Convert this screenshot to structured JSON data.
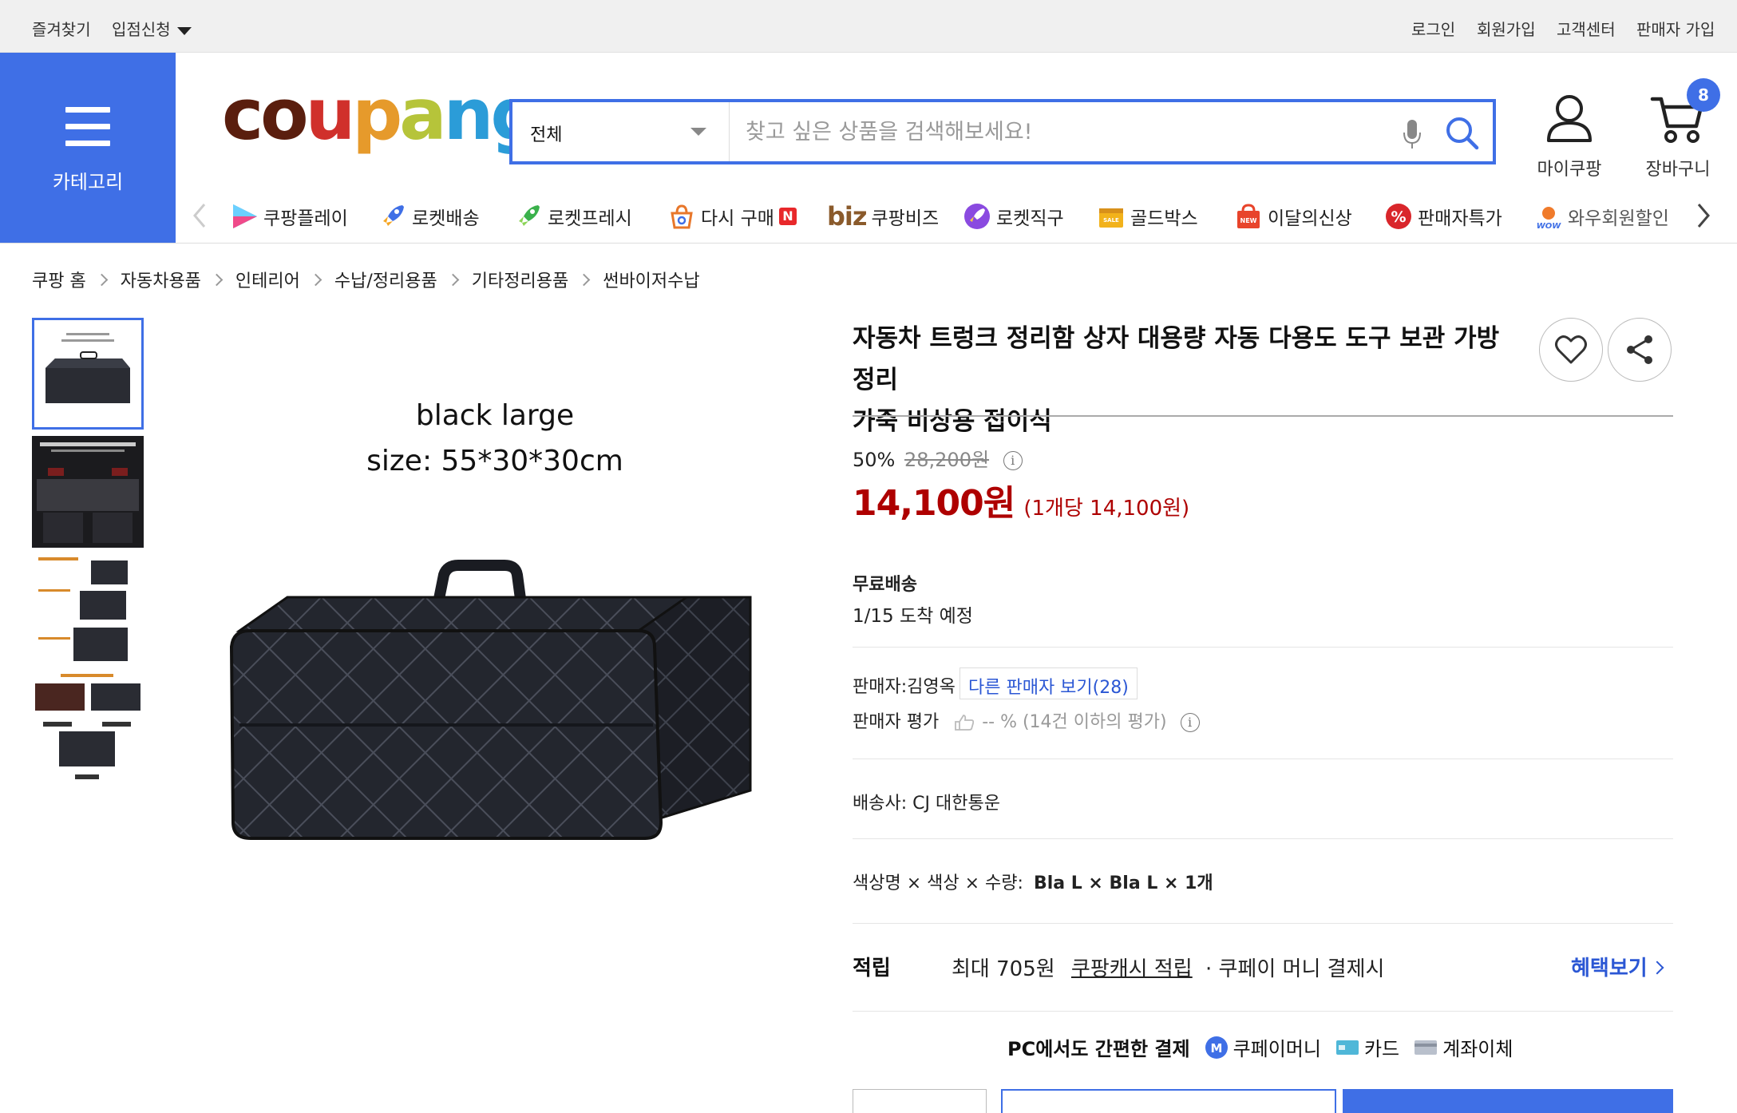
{
  "topbar": {
    "left": [
      "즐겨찾기",
      "입점신청"
    ],
    "right": [
      "로그인",
      "회원가입",
      "고객센터",
      "판매자 가입"
    ]
  },
  "header": {
    "category_label": "카테고리",
    "logo_text": "coupang",
    "search": {
      "category": "전체",
      "placeholder": "찾고 싶은 상품을 검색해보세요!"
    },
    "my_coupang": "마이쿠팡",
    "cart": "장바구니",
    "cart_count": "8"
  },
  "nav": [
    {
      "label": "쿠팡플레이",
      "icon": "play-icon"
    },
    {
      "label": "로켓배송",
      "icon": "rocket-icon"
    },
    {
      "label": "로켓프레시",
      "icon": "rocket-fresh-icon"
    },
    {
      "label": "다시 구매",
      "icon": "rebuy-icon",
      "badge": "N"
    },
    {
      "label": "쿠팡비즈",
      "prefix": "biz",
      "icon": "biz-icon"
    },
    {
      "label": "로켓직구",
      "icon": "rocket-global-icon"
    },
    {
      "label": "골드박스",
      "icon": "goldbox-icon"
    },
    {
      "label": "이달의신상",
      "icon": "new-bag-icon"
    },
    {
      "label": "판매자특가",
      "icon": "percent-icon"
    },
    {
      "label": "와우회원할인",
      "icon": "wow-icon"
    }
  ],
  "breadcrumb": [
    "쿠팡 홈",
    "자동차용품",
    "인테리어",
    "수납/정리용품",
    "기타정리용품",
    "썬바이저수납"
  ],
  "image": {
    "line1": "black  large",
    "line2": "size: 55*30*30cm"
  },
  "product": {
    "title_line1": "자동차 트렁크 정리함 상자 대용량 자동 다용도 도구 보관 가방 정리",
    "title_line2": "가죽 비상용 접이식",
    "discount": "50%",
    "original_price": "28,200원",
    "price": "14,100원",
    "unit_price": "(1개당 14,100원)",
    "shipping_label": "무료배송",
    "arrival": "1/15 도착 예정",
    "seller": "판매자:김영옥",
    "other_sellers": "다른 판매자 보기(28)",
    "seller_rating_label": "판매자 평가",
    "seller_rating_value": "-- % (14건 이하의 평가)",
    "courier": "배송사:  CJ 대한통운",
    "option": "색상명 × 색상 × 수량:",
    "option_value": "Bla L × Bla L × 1개",
    "reward_label": "적립",
    "reward_amount": "최대 705원",
    "reward_link": "쿠팡캐시 적립",
    "reward_suffix": "· 쿠페이 머니 결제시",
    "benefit_link": "혜택보기",
    "pay_title": "PC에서도 간편한 결제",
    "pay_methods": [
      "쿠페이머니",
      "카드",
      "계좌이체"
    ]
  },
  "colors": {
    "brand_blue": "#3f6fe6",
    "price_red": "#ae0000",
    "link_blue": "#2b57d4"
  }
}
